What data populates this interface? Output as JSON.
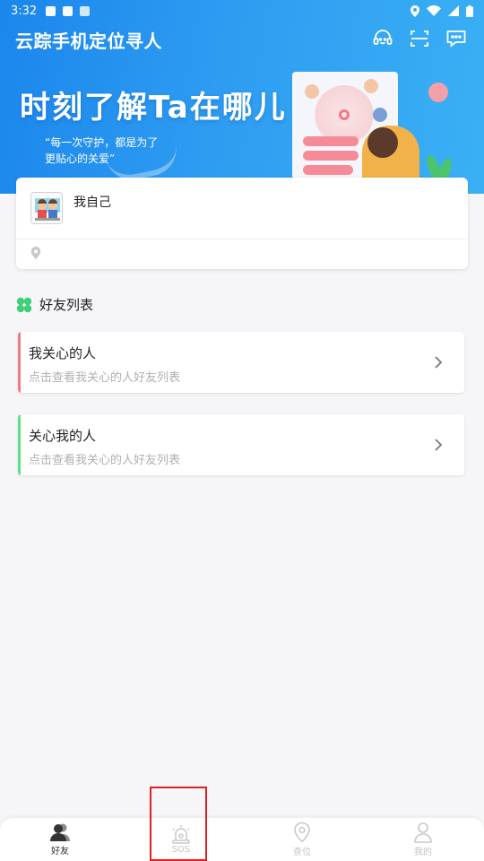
{
  "status_bar": {
    "time": "3:32"
  },
  "app": {
    "title": "云踪手机定位寻人"
  },
  "banner": {
    "headline": "时刻了解Ta在哪儿",
    "subtitle_line1": "“每一次守护，都是为了",
    "subtitle_line2": "更贴心的关爱”"
  },
  "profile": {
    "name": "我自己",
    "location": ""
  },
  "friends_section": {
    "title": "好友列表",
    "items": [
      {
        "title": "我关心的人",
        "subtitle": "点击查看我关心的人好友列表",
        "accent": "#f07b86"
      },
      {
        "title": "关心我的人",
        "subtitle": "点击查看我关心的人好友列表",
        "accent": "#5ee08a"
      }
    ]
  },
  "bottom_nav": {
    "items": [
      {
        "label": "好友",
        "icon": "friends-icon",
        "active": true
      },
      {
        "label": "SOS",
        "icon": "sos-alarm-icon",
        "active": false
      },
      {
        "label": "查位",
        "icon": "location-pin-icon",
        "active": false
      },
      {
        "label": "我的",
        "icon": "person-icon",
        "active": false
      }
    ]
  },
  "colors": {
    "header_blue": "#1b86ec",
    "accent_red": "#f07b86",
    "accent_green": "#5ee08a",
    "highlight": "#e02020"
  }
}
